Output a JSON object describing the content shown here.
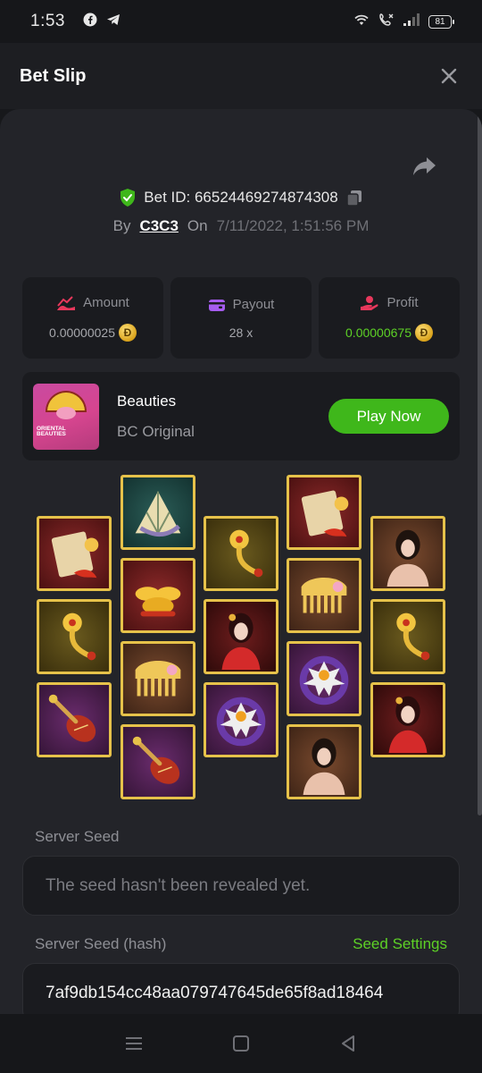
{
  "status_bar": {
    "time": "1:53",
    "battery": "81"
  },
  "header": {
    "title": "Bet Slip"
  },
  "bet": {
    "id_text": "Bet ID: 66524469274874308",
    "by_label": "By",
    "user": "C3C3",
    "on_label": "On",
    "date": "7/11/2022, 1:51:56 PM"
  },
  "stats": {
    "amount_label": "Amount",
    "amount_value": "0.00000025",
    "payout_label": "Payout",
    "payout_value": "28 x",
    "profit_label": "Profit",
    "profit_value": "0.00000675",
    "coin_symbol": "Ð"
  },
  "game": {
    "thumb_text": "ORIENTAL BEAUTIES",
    "name": "Beauties",
    "provider": "BC Original",
    "play_label": "Play Now"
  },
  "reels": [
    [
      "fan-koi",
      "jade-hairpin",
      "pipa-lute"
    ],
    [
      "folding-fan",
      "gold-ingots",
      "jade-comb",
      "pipa-lute"
    ],
    [
      "jade-hairpin",
      "beauty-red",
      "lotus-ring"
    ],
    [
      "fan-koi",
      "jade-comb",
      "lotus-ring",
      "beauty-bare"
    ],
    [
      "beauty-bare",
      "jade-hairpin",
      "beauty-red"
    ]
  ],
  "seeds": {
    "server_seed_label": "Server Seed",
    "server_seed_value": "The seed hasn't been revealed yet.",
    "hash_label": "Server Seed (hash)",
    "settings_label": "Seed Settings",
    "hash_value": "7af9db154cc48aa079747645de65f8ad18464"
  },
  "colors": {
    "accent_green": "#3fb71b",
    "gold_border": "#e6c24a",
    "background": "#232429"
  }
}
